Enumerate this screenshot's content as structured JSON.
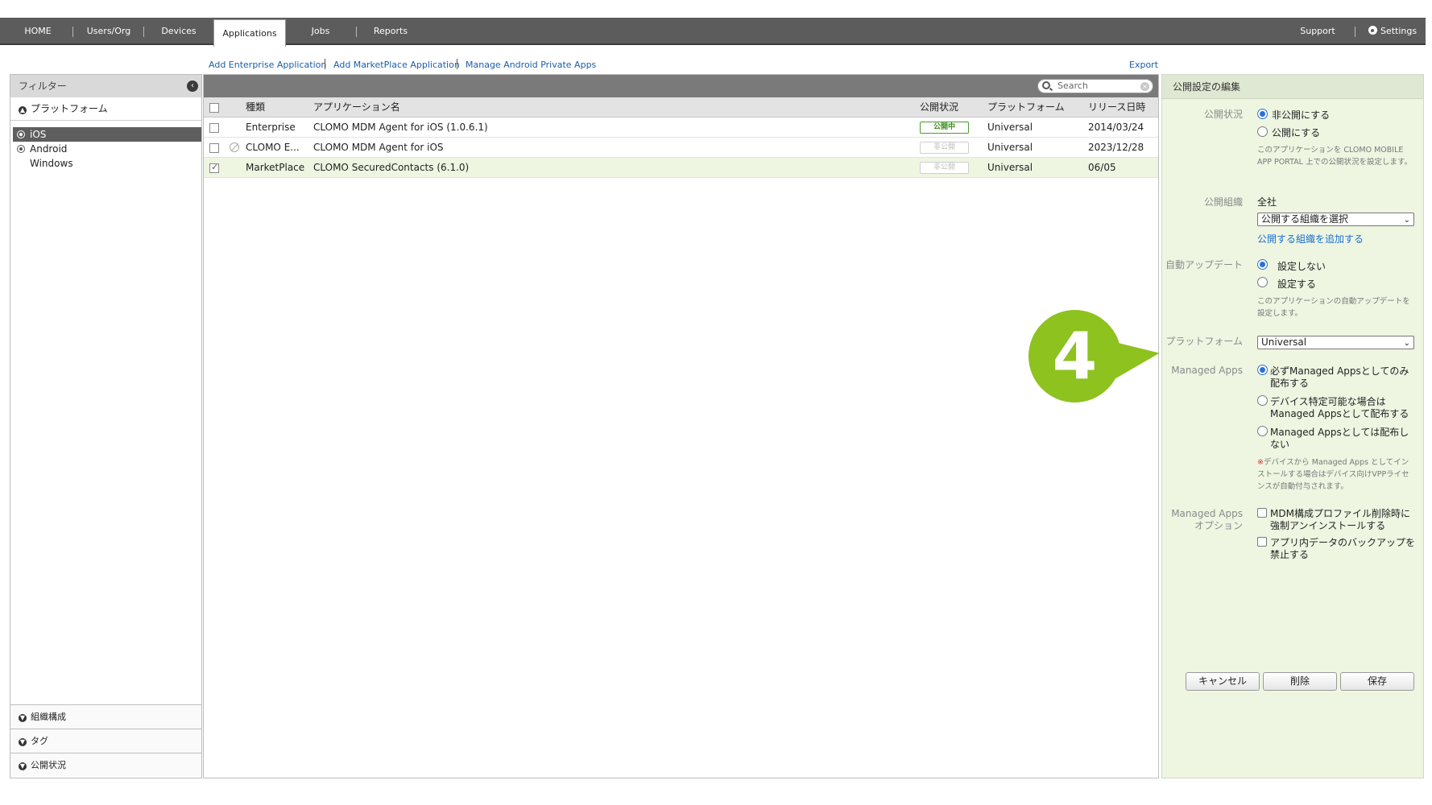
{
  "nav": {
    "items": [
      "HOME",
      "Users/Org",
      "Devices",
      "Applications",
      "Jobs",
      "Reports"
    ],
    "active": "Applications",
    "support": "Support",
    "settings": "Settings"
  },
  "actions": {
    "add_enterprise": "Add Enterprise Application",
    "add_marketplace": "Add MarketPlace Application",
    "manage_android": "Manage Android Private Apps",
    "export": "Export"
  },
  "filter": {
    "title": "フィルター",
    "platform_section": "プラットフォーム",
    "platforms": [
      "iOS",
      "Android",
      "Windows"
    ],
    "selected_platform": "iOS",
    "bottom_sections": [
      "組織構成",
      "タグ",
      "公開状況"
    ]
  },
  "list": {
    "search_placeholder": "Search",
    "columns": [
      "種類",
      "アプリケーション名",
      "公開状況",
      "プラットフォーム",
      "リリース日時"
    ],
    "rows": [
      {
        "type": "Enterprise",
        "name": "CLOMO MDM Agent for iOS (1.0.6.1)",
        "status": "公開中",
        "platform": "Universal",
        "date": "2014/03/24",
        "checked": false
      },
      {
        "type": "CLOMO E...",
        "name": "CLOMO MDM Agent for iOS",
        "status": "非公開",
        "platform": "Universal",
        "date": "2023/12/28",
        "checked": false
      },
      {
        "type": "MarketPlace",
        "name": "CLOMO SecuredContacts (6.1.0)",
        "status": "非公開",
        "platform": "Universal",
        "date": "06/05",
        "checked": true
      }
    ]
  },
  "edit": {
    "title": "公開設定の編集",
    "publish_label": "公開状況",
    "publish_options": [
      "非公開にする",
      "公開にする"
    ],
    "publish_note": "このアプリケーションを CLOMO MOBILE APP PORTAL 上での公開状況を設定します。",
    "org_label": "公開組織",
    "org_value": "全社",
    "org_select": "公開する組織を選択",
    "org_add_link": "公開する組織を追加する",
    "autoupdate_label": "自動アップデート",
    "autoupdate_options": [
      "設定しない",
      "設定する"
    ],
    "autoupdate_note": "このアプリケーションの自動アップデートを設定します。",
    "platform_label": "プラットフォーム",
    "platform_value": "Universal",
    "managed_label": "Managed Apps",
    "managed_options": [
      "必ずManaged Appsとしてのみ配布する",
      "デバイス特定可能な場合はManaged Appsとして配布する",
      "Managed Appsとしては配布しない"
    ],
    "managed_note_mark": "※",
    "managed_note": "デバイスから Managed Apps としてインストールする場合はデバイス向けVPPライセンスが自動付与されます。",
    "managed_opt_label_1": "Managed Apps",
    "managed_opt_label_2": "オプション",
    "managed_opt_options": [
      "MDM構成プロファイル削除時に強制アンインストールする",
      "アプリ内データのバックアップを禁止する"
    ],
    "cancel": "キャンセル",
    "delete": "削除",
    "save": "保存"
  },
  "callout": {
    "number": "4",
    "color": "#8dc21f"
  }
}
